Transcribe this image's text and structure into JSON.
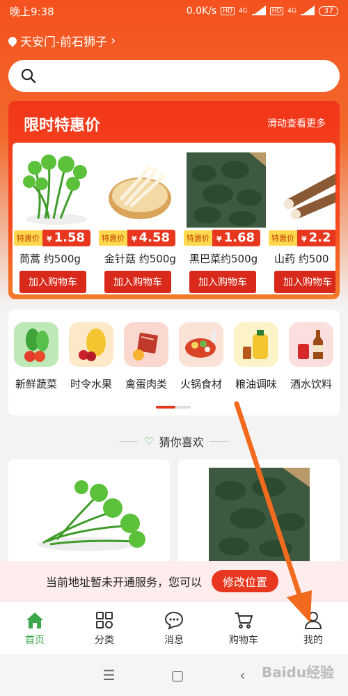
{
  "status_bar": {
    "time": "晚上9:38",
    "net_speed": "0.0K/s",
    "hd1": "HD",
    "sig1": "4G",
    "hd2": "HD",
    "sig2": "4G",
    "battery": "37"
  },
  "location": {
    "text": "天安门-前石狮子"
  },
  "search": {
    "placeholder": ""
  },
  "promo": {
    "title": "限时特惠价",
    "more": "滑动查看更多",
    "products": [
      {
        "tag": "特惠价",
        "currency": "¥",
        "price": "1.58",
        "name": "茼蒿 约500g",
        "button": "加入购物车"
      },
      {
        "tag": "特惠价",
        "currency": "¥",
        "price": "4.58",
        "name": "金针菇 约500g",
        "button": "加入购物车"
      },
      {
        "tag": "特惠价",
        "currency": "¥",
        "price": "1.68",
        "name": "黑巴菜约500g",
        "button": "加入购物车"
      },
      {
        "tag": "特惠价",
        "currency": "¥",
        "price": "2.2",
        "name": "山药 约500",
        "button": "加入购物车"
      }
    ]
  },
  "categories": [
    {
      "label": "新鲜蔬菜",
      "icon": "vegetable-icon"
    },
    {
      "label": "时令水果",
      "icon": "fruit-icon"
    },
    {
      "label": "禽蛋肉类",
      "icon": "meat-icon"
    },
    {
      "label": "火锅食材",
      "icon": "hotpot-icon"
    },
    {
      "label": "粮油调味",
      "icon": "oil-icon"
    },
    {
      "label": "酒水饮料",
      "icon": "drinks-icon"
    }
  ],
  "guess": {
    "title": "猜你喜欢"
  },
  "notice": {
    "text": "当前地址暂未开通服务，您可以",
    "button": "修改位置"
  },
  "tabs": [
    {
      "label": "首页",
      "icon": "home-icon"
    },
    {
      "label": "分类",
      "icon": "grid-icon"
    },
    {
      "label": "消息",
      "icon": "message-icon"
    },
    {
      "label": "购物车",
      "icon": "cart-icon"
    },
    {
      "label": "我的",
      "icon": "user-icon"
    }
  ],
  "watermark": {
    "text": "Baidu经验"
  },
  "colors": {
    "primary": "#e8371f",
    "accent_green": "#3aa84a",
    "tag_yellow": "#ffd84d"
  }
}
